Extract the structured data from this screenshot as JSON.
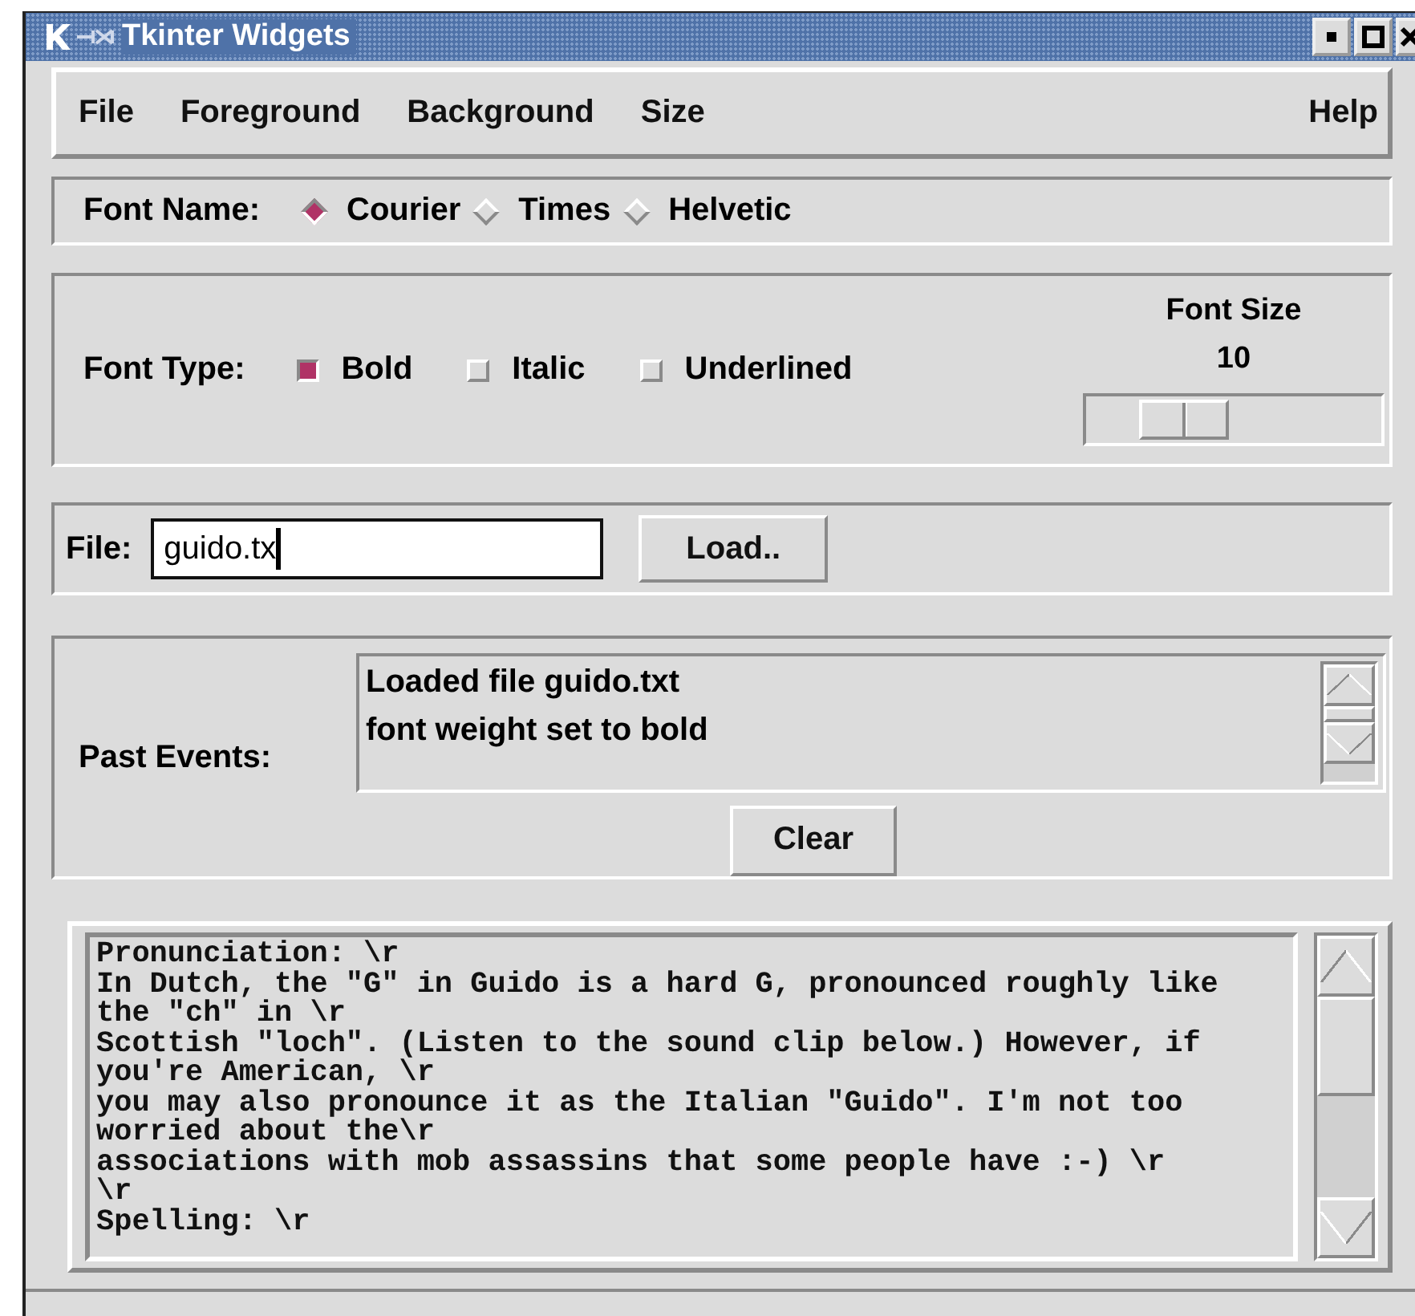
{
  "window": {
    "title": "Tkinter Widgets"
  },
  "menu": {
    "items": [
      {
        "label": "File"
      },
      {
        "label": "Foreground"
      },
      {
        "label": "Background"
      },
      {
        "label": "Size"
      }
    ],
    "help": "Help"
  },
  "font_name": {
    "label": "Font Name:",
    "options": [
      {
        "label": "Courier",
        "selected": true
      },
      {
        "label": "Times",
        "selected": false
      },
      {
        "label": "Helvetic",
        "selected": false
      }
    ]
  },
  "font_type": {
    "label": "Font Type:",
    "options": [
      {
        "label": "Bold",
        "checked": true
      },
      {
        "label": "Italic",
        "checked": false
      },
      {
        "label": "Underlined",
        "checked": false
      }
    ]
  },
  "font_size": {
    "label": "Font Size",
    "value": "10",
    "level": 0.33
  },
  "file": {
    "label": "File:",
    "value": "guido.tx",
    "button": "Load.."
  },
  "events": {
    "label": "Past Events:",
    "items": [
      "Loaded file guido.txt",
      "font weight set to bold"
    ],
    "button": "Clear"
  },
  "text_lines": [
    "Pronunciation: \\r",
    "In Dutch, the \"G\" in Guido is a hard G, pronounced roughly like",
    "the \"ch\" in \\r",
    "Scottish \"loch\". (Listen to the sound clip below.) However, if",
    "you're American, \\r",
    "you may also pronounce it as the Italian \"Guido\". I'm not too",
    "worried about the\\r",
    "associations with mob assassins that some people have :-) \\r",
    "\\r",
    "Spelling: \\r"
  ]
}
